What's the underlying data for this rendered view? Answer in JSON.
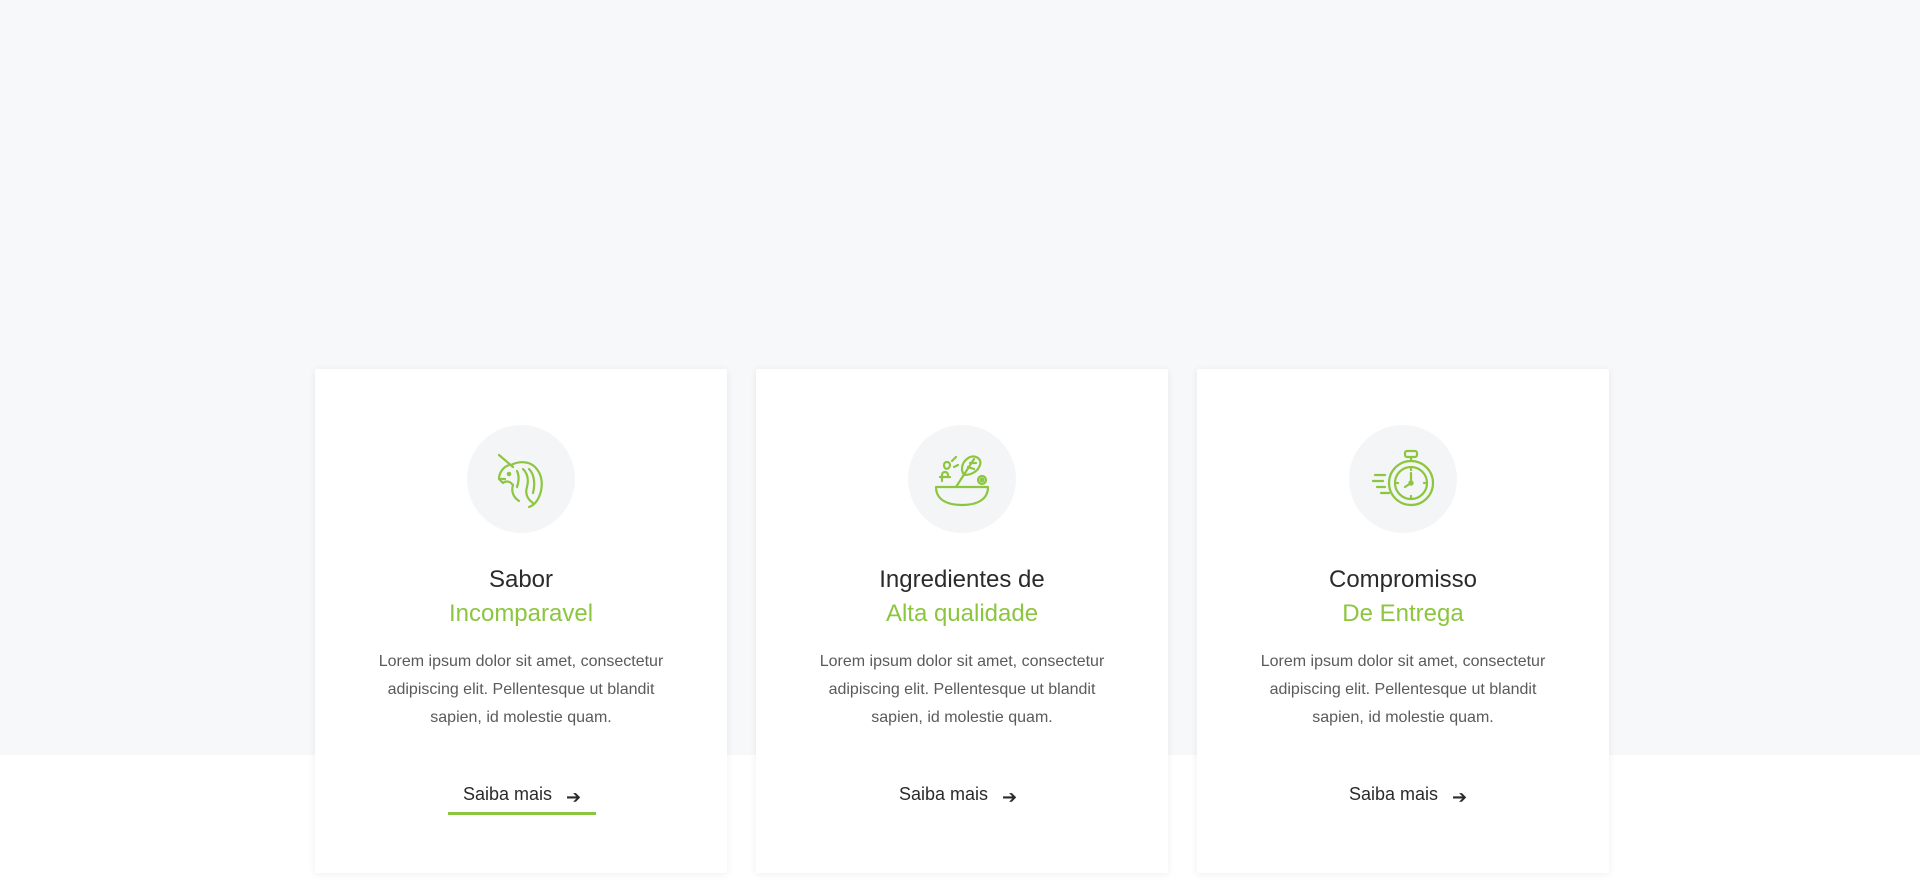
{
  "accent_color": "#8cc63f",
  "cards": [
    {
      "icon": "unicorn-icon",
      "title_line1": "Sabor",
      "title_line2": "Incomparavel",
      "description": "Lorem ipsum dolor sit amet, consectetur adipiscing elit. Pellentesque ut blandit sapien, id molestie quam.",
      "link_label": "Saiba mais",
      "link_icon": "arrow-right-icon",
      "active": true
    },
    {
      "icon": "salad-bowl-icon",
      "title_line1": "Ingredientes de",
      "title_line2": "Alta qualidade",
      "description": "Lorem ipsum dolor sit amet, consectetur adipiscing elit. Pellentesque ut blandit sapien, id molestie quam.",
      "link_label": "Saiba mais",
      "link_icon": "arrow-right-icon",
      "active": false
    },
    {
      "icon": "stopwatch-icon",
      "title_line1": "Compromisso",
      "title_line2": "De Entrega",
      "description": "Lorem ipsum dolor sit amet, consectetur adipiscing elit. Pellentesque ut blandit sapien, id molestie quam.",
      "link_label": "Saiba mais",
      "link_icon": "arrow-right-icon",
      "active": false
    }
  ]
}
